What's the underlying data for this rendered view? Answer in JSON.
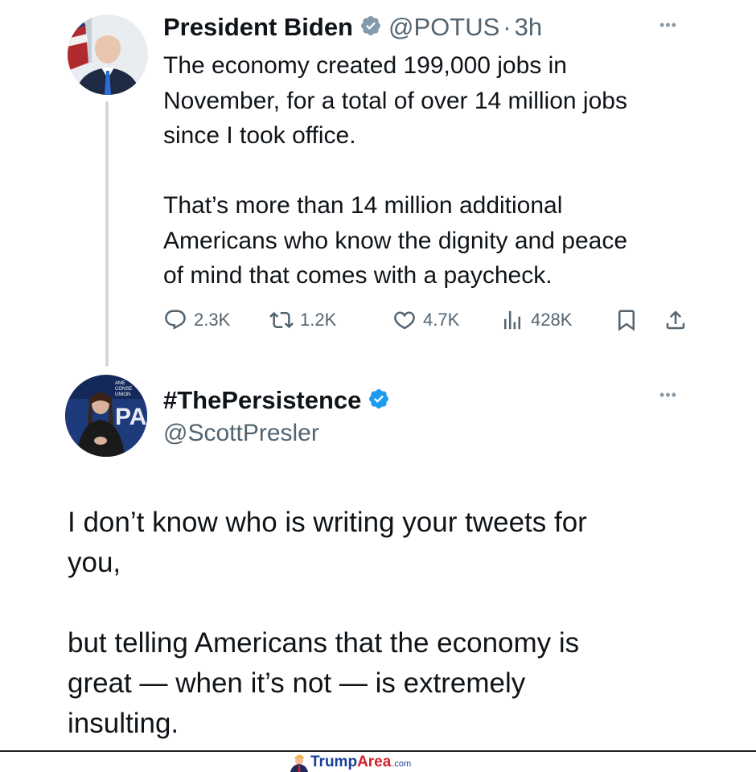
{
  "tweet1": {
    "author_name": "President Biden",
    "handle": "@POTUS",
    "separator": "·",
    "time": "3h",
    "text": "The economy created 199,000 jobs in\nNovember, for a total of over 14 million jobs\nsince I took office.\n\nThat’s more than 14 million additional\nAmericans who know the dignity and peace\nof mind that comes with a paycheck.",
    "stats": {
      "replies": "2.3K",
      "reposts": "1.2K",
      "likes": "4.7K",
      "views": "428K"
    },
    "badge": "gray-verified-icon"
  },
  "tweet2": {
    "author_name": "#ThePersistence",
    "handle": "@ScottPresler",
    "badge": "blue-verified-icon",
    "text": "I don’t know who is writing your tweets for\nyou,\n\nbut telling Americans that the economy is\ngreat — when it’s not — is extremely\ninsulting."
  },
  "footer": {
    "brand_part1": "Trump",
    "brand_part2": "Area",
    "brand_suffix": ".com"
  },
  "colors": {
    "text": "#0f1419",
    "secondary": "#536471",
    "verified_blue": "#1d9bf0",
    "verified_gray": "#829aab",
    "brand_blue": "#1a3f9a",
    "brand_red": "#d4202a"
  }
}
